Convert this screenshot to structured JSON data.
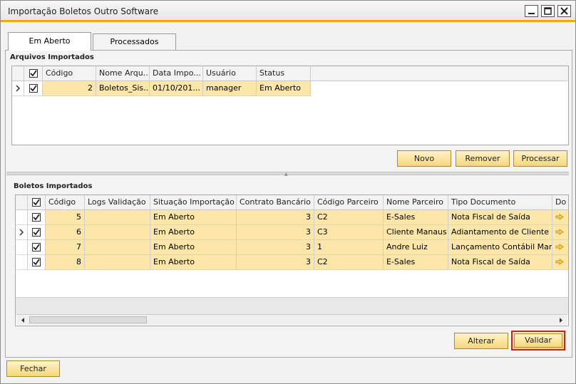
{
  "window": {
    "title": "Importação Boletos Outro Software"
  },
  "tabs": [
    {
      "label": "Em Aberto"
    },
    {
      "label": "Processados"
    }
  ],
  "arquivos": {
    "section_title": "Arquivos Importados",
    "columns": [
      "Código",
      "Nome Arqu...",
      "Data Impo...",
      "Usuário",
      "Status"
    ],
    "rows": [
      {
        "checked": true,
        "codigo": "2",
        "nome": "Boletos_Sis...",
        "data": "01/10/201...",
        "usuario": "manager",
        "status": "Em Aberto"
      }
    ],
    "buttons": {
      "novo": "Novo",
      "remover": "Remover",
      "processar": "Processar"
    }
  },
  "boletos": {
    "section_title": "Boletos Importados",
    "columns": [
      "Código",
      "Logs Validação",
      "Situação Importação",
      "Contrato Bancário",
      "Código Parceiro",
      "Nome Parceiro",
      "Tipo Documento",
      "Do"
    ],
    "rows": [
      {
        "checked": true,
        "codigo": "5",
        "logs": "",
        "situacao": "Em Aberto",
        "contrato": "3",
        "cod_parceiro": "C2",
        "nome_parceiro": "E-Sales",
        "tipo_doc": "Nota Fiscal de Saída"
      },
      {
        "checked": true,
        "codigo": "6",
        "logs": "",
        "situacao": "Em Aberto",
        "contrato": "3",
        "cod_parceiro": "C3",
        "nome_parceiro": "Cliente Manaus",
        "tipo_doc": "Adiantamento de Cliente"
      },
      {
        "checked": true,
        "codigo": "7",
        "logs": "",
        "situacao": "Em Aberto",
        "contrato": "3",
        "cod_parceiro": "1",
        "nome_parceiro": "Andre Luiz",
        "tipo_doc": "Lançamento Contábil Manual"
      },
      {
        "checked": true,
        "codigo": "8",
        "logs": "",
        "situacao": "Em Aberto",
        "contrato": "3",
        "cod_parceiro": "C2",
        "nome_parceiro": "E-Sales",
        "tipo_doc": "Nota Fiscal de Saída"
      }
    ],
    "buttons": {
      "alterar": "Alterar",
      "validar": "Validar"
    }
  },
  "footer": {
    "fechar": "Fechar"
  },
  "colors": {
    "accent": "#f0ab00",
    "row_bg": "#fde7a8",
    "highlight": "#cc1f1f"
  }
}
